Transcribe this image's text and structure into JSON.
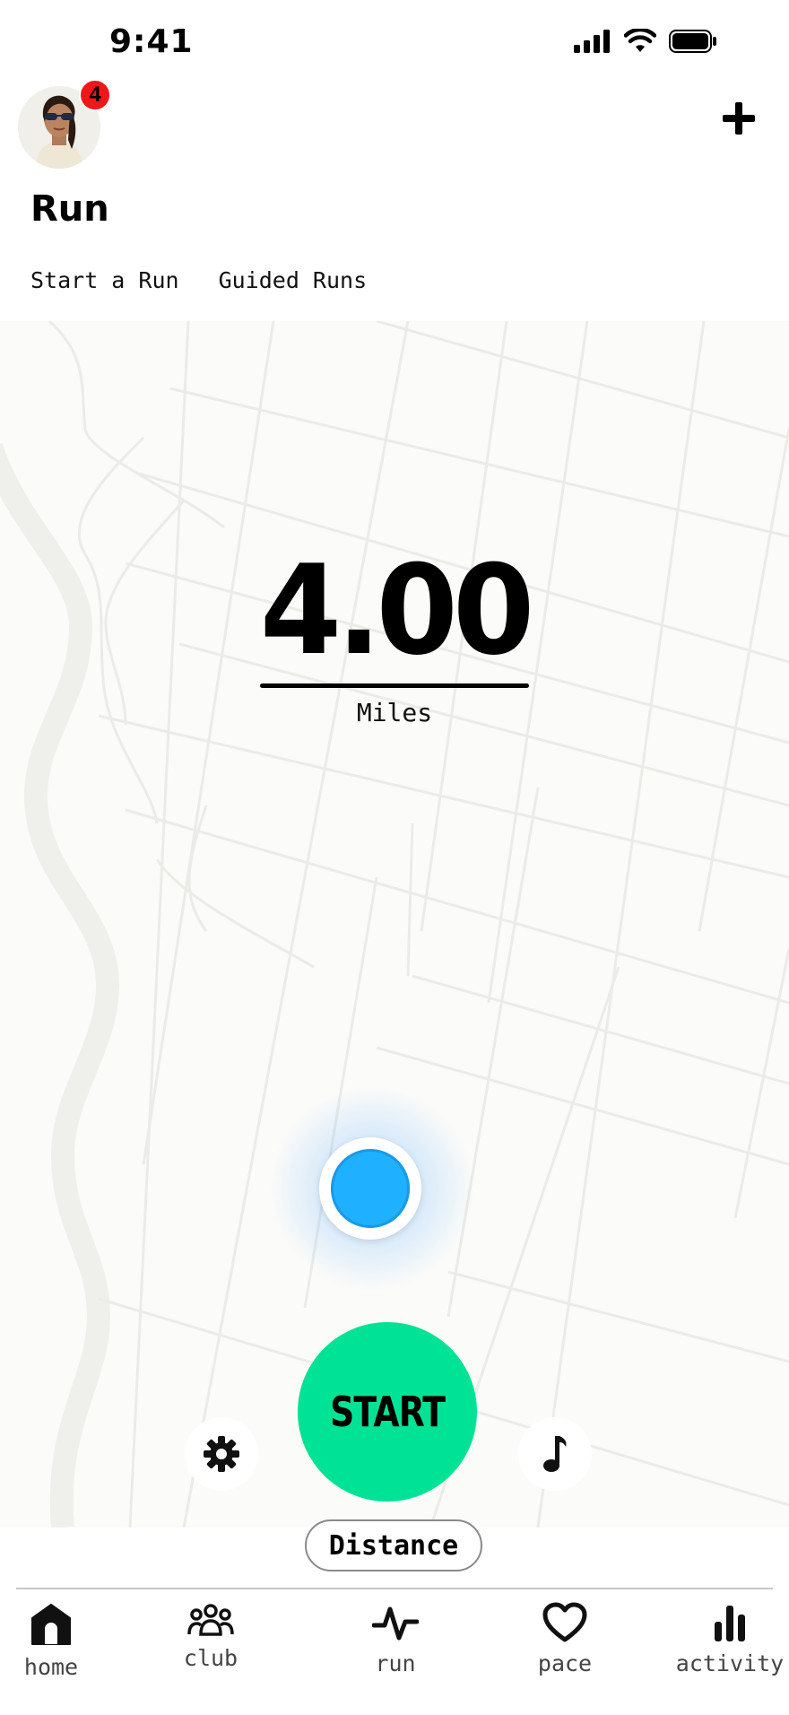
{
  "status_bar": {
    "time": "9:41"
  },
  "header": {
    "notification_count": "4",
    "title": "Run",
    "tabs": [
      "Start a Run",
      "Guided Runs"
    ]
  },
  "run": {
    "distance_value": "4.00",
    "distance_unit": "Miles",
    "start_label": "START",
    "mode_label": "Distance"
  },
  "nav": {
    "items": [
      {
        "label": "home",
        "icon": "home-icon"
      },
      {
        "label": "club",
        "icon": "club-icon"
      },
      {
        "label": "run",
        "icon": "run-pulse-icon"
      },
      {
        "label": "pace",
        "icon": "heart-icon"
      },
      {
        "label": "activity",
        "icon": "bar-chart-icon"
      }
    ]
  },
  "colors": {
    "start_button": "#00e397",
    "location_dot": "#1fb1ff",
    "badge": "#f0161a",
    "map_background": "#fbfbf9"
  }
}
